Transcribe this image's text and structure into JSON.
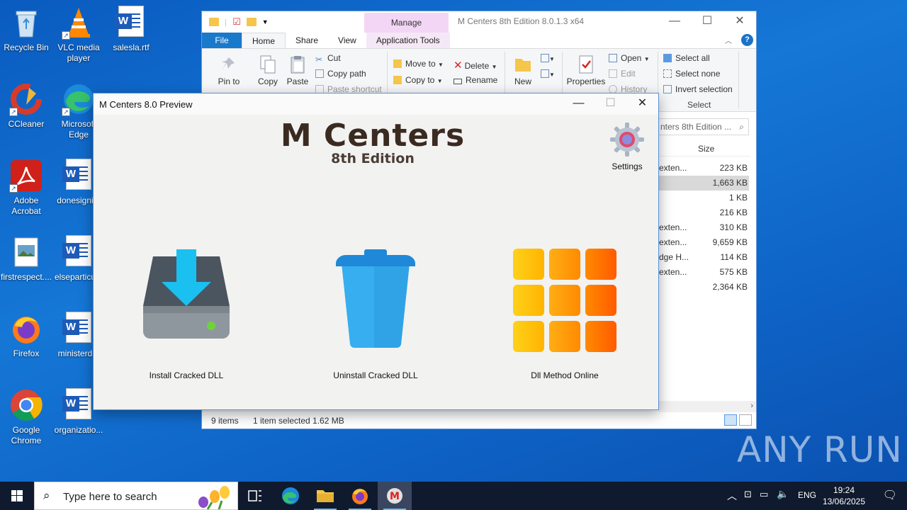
{
  "desktop": {
    "icons": [
      {
        "label": "Recycle Bin"
      },
      {
        "label": "VLC media player"
      },
      {
        "label": "salesla.rtf"
      },
      {
        "label": "CCleaner"
      },
      {
        "label": "Microsoft Edge"
      },
      {
        "label": "Adobe Acrobat"
      },
      {
        "label": "donesigni..."
      },
      {
        "label": "firstrespect...."
      },
      {
        "label": "elseparticu..."
      },
      {
        "label": "Firefox"
      },
      {
        "label": "ministerd..."
      },
      {
        "label": "Google Chrome"
      },
      {
        "label": "organizatio..."
      }
    ]
  },
  "explorer": {
    "manage_tab": "Manage",
    "title": "M Centers 8th Edition 8.0.1.3 x64",
    "tabs": {
      "file": "File",
      "home": "Home",
      "share": "Share",
      "view": "View",
      "app_tools": "Application Tools"
    },
    "ribbon": {
      "pin": "Pin to Quick access",
      "copy": "Copy",
      "paste": "Paste",
      "cut": "Cut",
      "copy_path": "Copy path",
      "paste_shortcut": "Paste shortcut",
      "move_to": "Move to",
      "copy_to": "Copy to",
      "delete": "Delete",
      "rename": "Rename",
      "new_folder": "New folder",
      "properties": "Properties",
      "open": "Open",
      "edit": "Edit",
      "history": "History",
      "select_all": "Select all",
      "select_none": "Select none",
      "invert_selection": "Invert selection",
      "select_group": "Select"
    },
    "search_placeholder": "nters 8th Edition ...",
    "size_header": "Size",
    "rows": [
      {
        "name": "exten...",
        "size": "223 KB"
      },
      {
        "name": "",
        "size": "1,663 KB"
      },
      {
        "name": "",
        "size": "1 KB"
      },
      {
        "name": "",
        "size": "216 KB"
      },
      {
        "name": "exten...",
        "size": "310 KB"
      },
      {
        "name": "exten...",
        "size": "9,659 KB"
      },
      {
        "name": "dge H...",
        "size": "114 KB"
      },
      {
        "name": "exten...",
        "size": "575 KB"
      },
      {
        "name": "",
        "size": "2,364 KB"
      }
    ],
    "status": {
      "items": "9 items",
      "selected": "1 item selected  1.62 MB"
    }
  },
  "mcenters": {
    "title": "M Centers 8.0 Preview",
    "brand": "M Centers",
    "edition": "8th Edition",
    "settings": "Settings",
    "actions": {
      "install": "Install Cracked DLL",
      "uninstall": "Uninstall Cracked DLL",
      "online": "Dll Method Online"
    }
  },
  "taskbar": {
    "search_placeholder": "Type here to search",
    "lang": "ENG",
    "time": "19:24",
    "date": "13/06/2025"
  },
  "watermark": "ANY RUN"
}
